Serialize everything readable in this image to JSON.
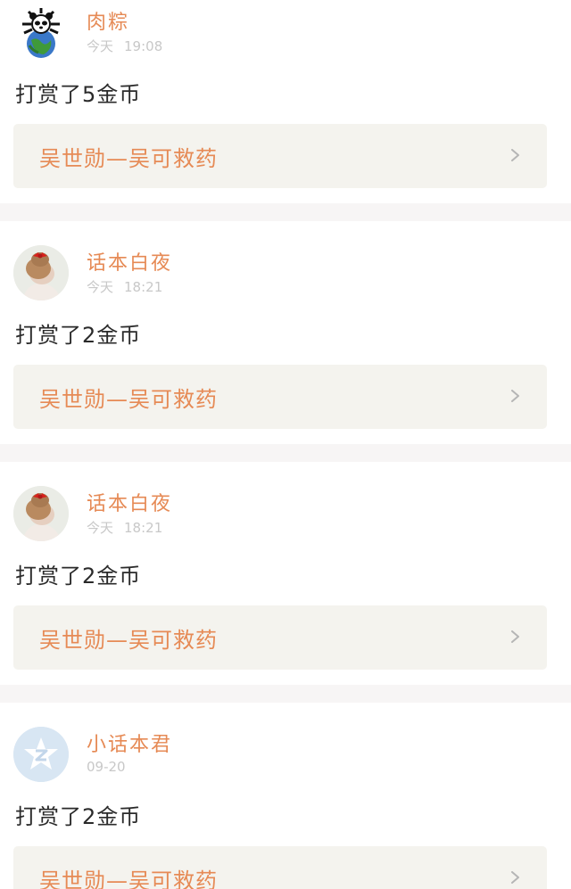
{
  "feed": {
    "items": [
      {
        "avatar_icon": "panda-earth-avatar-icon",
        "username": "肉粽",
        "day": "今天",
        "time": "19:08",
        "reward": "打赏了5金币",
        "book_title": "吴世勋—吴可救药",
        "chevron_icon": "chevron-right-icon"
      },
      {
        "avatar_icon": "girl-hair-bun-avatar-icon",
        "username": "话本白夜",
        "day": "今天",
        "time": "18:21",
        "reward": "打赏了2金币",
        "book_title": "吴世勋—吴可救药",
        "chevron_icon": "chevron-right-icon"
      },
      {
        "avatar_icon": "girl-hair-bun-avatar-icon",
        "username": "话本白夜",
        "day": "今天",
        "time": "18:21",
        "reward": "打赏了2金币",
        "book_title": "吴世勋—吴可救药",
        "chevron_icon": "chevron-right-icon"
      },
      {
        "avatar_icon": "default-star-avatar-icon",
        "username": "小话本君",
        "day": "",
        "time": "09-20",
        "reward": "打赏了2金币",
        "book_title": "吴世勋—吴可救药",
        "chevron_icon": "chevron-right-icon"
      }
    ]
  },
  "colors": {
    "accent": "#e68a55",
    "link_background": "#f4f3ee",
    "page_background": "#f7f5f5",
    "timestamp": "#c8c8c8",
    "text": "#2a2a2a"
  }
}
